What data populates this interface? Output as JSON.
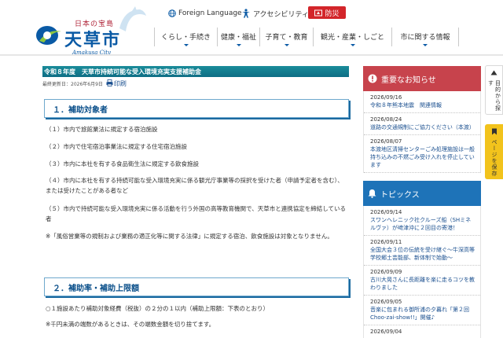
{
  "header": {
    "logo_sub": "日本の宝島",
    "logo_main": "天草市",
    "logo_roman": "Amakusa City",
    "foreign_language": "Foreign Language",
    "accessibility": "アクセシビリティ",
    "bousai": "防災"
  },
  "gnav": [
    {
      "label": "くらし・手続き"
    },
    {
      "label": "健康・福祉"
    },
    {
      "label": "子育て・教育"
    },
    {
      "label": "観光・産業・しごと"
    },
    {
      "label": "市に関する情報"
    }
  ],
  "main": {
    "title": "令和８年度　天草市持続可能な受入環境充実支援補助金",
    "updated": "最終更新日：2026年6月9日",
    "print": "印刷",
    "section1": "１．補助対象者",
    "items": [
      "（１）市内で旅館業法に規定する宿泊施設",
      "（２）市内で住宅宿泊事業法に規定する住宅宿泊施設",
      "（３）市内に本社を有する食品衛生法に規定する飲食施設",
      "（４）市内に本社を有する持続可能な受入環境充実に係る観光庁事業等の採択を受けた者（申請予定者を含む）、または受けたことがある者など",
      "（５）市内で持続可能な受入環境充実に係る活動を行う外国の高等教育機関で、天草市と連携協定を締結している者"
    ],
    "note": "※「風俗営業等の規制および業務の適正化等に関する法律」に規定する宿泊、飲食施設は対象となりません。",
    "section2": "２．補助率・補助上限額",
    "rate": "○１施設あたり補助対象経費（税抜）の２分の１以内（補助上限額：下表のとおり）",
    "rate_note": "※千円未満の端数があるときは、その端数金額を切り捨てます。"
  },
  "sidebar": {
    "important_title": "重要なお知らせ",
    "important": [
      {
        "date": "2026/09/16",
        "text": "令和８年熊本地震　関連情報"
      },
      {
        "date": "2026/08/24",
        "text": "道路の交通規制にご協力ください（本渡）"
      },
      {
        "date": "2026/08/07",
        "text": "本渡地区清掃センターごみ処理施設は一般持ち込みの不燃ごみ受け入れを停止しています"
      }
    ],
    "topics_title": "トピックス",
    "topics": [
      {
        "date": "2026/09/14",
        "text": "スワンヘレニック社クルーズ船（SHミネルヴァ）が﨑津沖に２回目の寄港！"
      },
      {
        "date": "2026/09/11",
        "text": "全国大会３位の伝統を受け継ぐ～牛深高等学校郷土芸能部、新体制で始動～"
      },
      {
        "date": "2026/09/09",
        "text": "古川大晃さんに長距離を楽に走るコツを教わりました"
      },
      {
        "date": "2026/09/05",
        "text": "音楽に包まれる御所浦の夕暮れ「第２回 Choo-zai-show!!」開催♪"
      },
      {
        "date": "2026/09/04",
        "text": ""
      }
    ]
  },
  "tabs": {
    "back": "目的から探す",
    "save": "ページを保存"
  },
  "colors": {
    "brand_blue": "#0a5aa5",
    "title_teal": "#1a8c9a",
    "important_red": "#c7434c",
    "topics_blue": "#1e73b8",
    "bousai_red": "#d3252a",
    "save_yellow": "#f2c31c"
  },
  "icons": [
    "globe-icon",
    "accessibility-icon",
    "disaster-icon",
    "print-icon",
    "alert-icon",
    "bell-icon",
    "arrow-up-icon",
    "bookmark-icon"
  ]
}
